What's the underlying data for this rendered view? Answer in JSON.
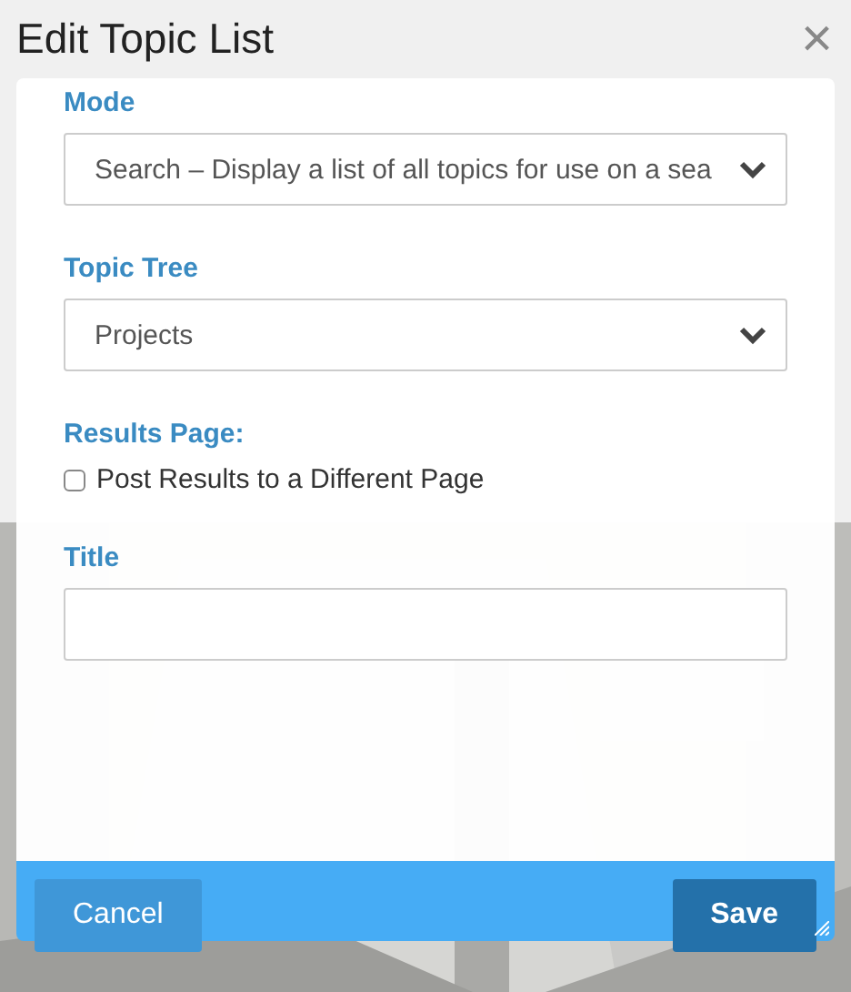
{
  "dialog": {
    "title": "Edit Topic List",
    "close": "×"
  },
  "fields": [
    {
      "kind": "select",
      "label": "Mode",
      "value": "Search – Display a list of all topics for use on a sea"
    },
    {
      "kind": "select",
      "label": "Topic Tree",
      "value": "Projects"
    },
    {
      "kind": "checkbox",
      "label": "Results Page:",
      "option": "Post Results to a Different Page",
      "checked": false
    },
    {
      "kind": "text",
      "label": "Title"
    }
  ],
  "buttons": [
    {
      "label": "Cancel",
      "kind": "secondary"
    },
    {
      "label": "Save",
      "kind": "primary"
    }
  ]
}
